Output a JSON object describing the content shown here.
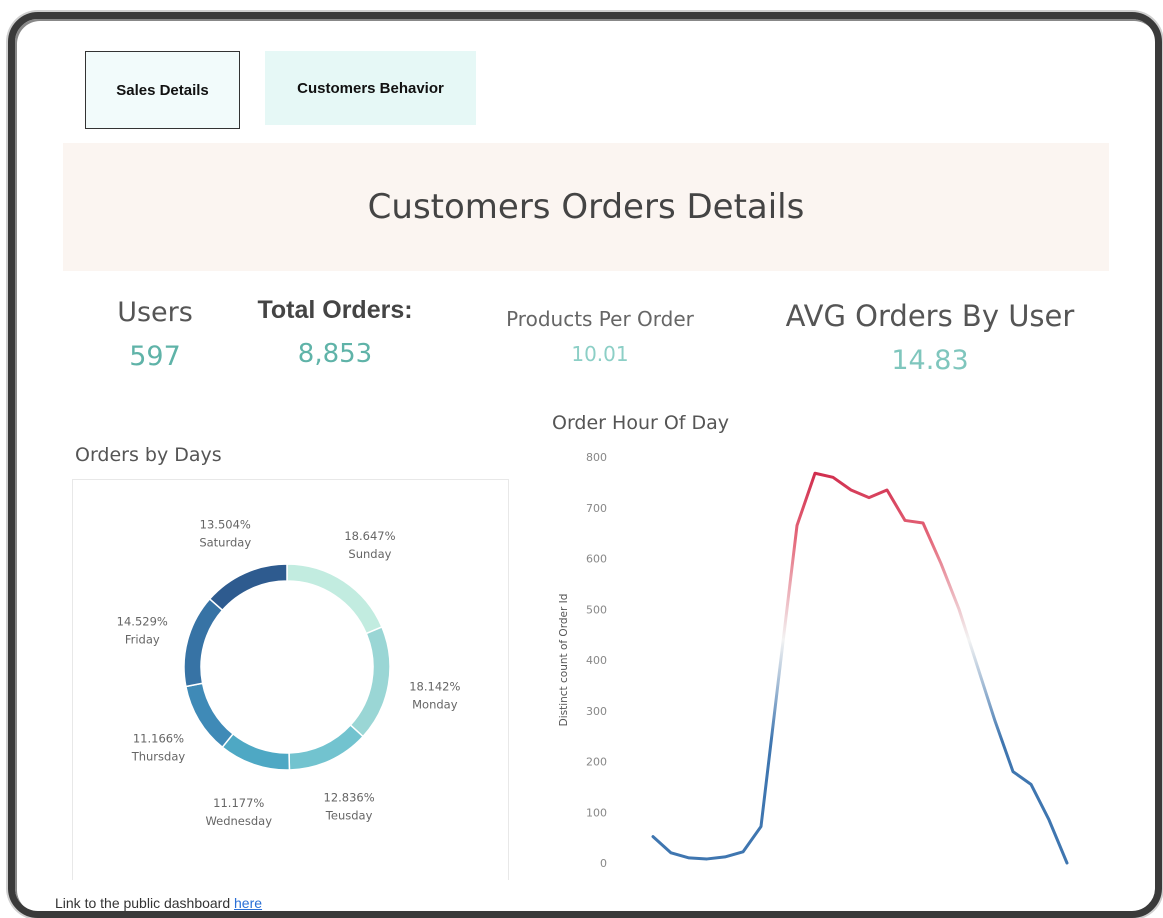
{
  "tabs": [
    {
      "label": "Sales Details"
    },
    {
      "label": "Customers Behavior"
    }
  ],
  "banner": {
    "title": "Customers Orders Details"
  },
  "kpis": {
    "users": {
      "label": "Users",
      "value": "597"
    },
    "total_orders": {
      "label": "Total Orders:",
      "value": "8,853"
    },
    "products_per_order": {
      "label": "Products Per Order",
      "value": "10.01"
    },
    "avg_orders_by_user": {
      "label": "AVG Orders By User",
      "value": "14.83"
    }
  },
  "footer": {
    "text": "Link to the public dashboard ",
    "link_label": "here"
  },
  "chart_data": [
    {
      "type": "pie",
      "title": "Orders by Days",
      "donut": true,
      "slices": [
        {
          "label": "Sunday",
          "value": 18.647,
          "pct_label": "18.647%",
          "color": "#c2ece0"
        },
        {
          "label": "Monday",
          "value": 18.142,
          "pct_label": "18.142%",
          "color": "#9ad6d5"
        },
        {
          "label": "Teusday",
          "value": 12.836,
          "pct_label": "12.836%",
          "color": "#72c3cf"
        },
        {
          "label": "Wednesday",
          "value": 11.177,
          "pct_label": "11.177%",
          "color": "#4ea8c4"
        },
        {
          "label": "Thursday",
          "value": 11.166,
          "pct_label": "11.166%",
          "color": "#3f8ab7"
        },
        {
          "label": "Friday",
          "value": 14.529,
          "pct_label": "14.529%",
          "color": "#3773a5"
        },
        {
          "label": "Saturday",
          "value": 13.504,
          "pct_label": "13.504%",
          "color": "#2e5b8f"
        }
      ]
    },
    {
      "type": "line",
      "title": "Order Hour Of Day",
      "ylabel": "Distinct count of Order Id",
      "xlabel": "",
      "ylim": [
        0,
        800
      ],
      "yticks": [
        0,
        100,
        200,
        300,
        400,
        500,
        600,
        700,
        800
      ],
      "x": [
        0,
        1,
        2,
        3,
        4,
        5,
        6,
        7,
        8,
        9,
        10,
        11,
        12,
        13,
        14,
        15,
        16,
        17,
        18,
        19,
        20,
        21,
        22,
        23
      ],
      "values": [
        52,
        20,
        10,
        8,
        12,
        22,
        72,
        370,
        665,
        768,
        760,
        735,
        720,
        735,
        675,
        670,
        590,
        500,
        390,
        280,
        180,
        155,
        85,
        0
      ],
      "color_low": "#3f76b0",
      "color_mid": "#f3f3f3",
      "color_high": "#cc1f43"
    }
  ]
}
